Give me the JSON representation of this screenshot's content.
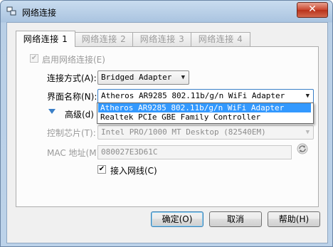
{
  "window": {
    "title": "网络连接",
    "close_label": "✕"
  },
  "tabs": [
    {
      "label": "网络连接 1",
      "active": true
    },
    {
      "label": "网络连接 2",
      "active": false
    },
    {
      "label": "网络连接 3",
      "active": false
    },
    {
      "label": "网络连接 4",
      "active": false
    }
  ],
  "enable_adapter": {
    "label": "启用网络连接(E)",
    "checked": true,
    "disabled": true
  },
  "attached_to": {
    "label": "连接方式(A):",
    "value": "Bridged Adapter"
  },
  "name": {
    "label": "界面名称(N):",
    "value": "Atheros AR9285 802.11b/g/n WiFi Adapter",
    "options": [
      "Atheros AR9285 802.11b/g/n WiFi Adapter",
      "Realtek PCIe GBE Family Controller"
    ],
    "selected_index": 0
  },
  "advanced": {
    "label": "高级(d)"
  },
  "adapter_type": {
    "label": "控制芯片(T):",
    "value": "Intel PRO/1000 MT Desktop (82540EM)"
  },
  "mac": {
    "label": "MAC 地址(M):",
    "value": "080027E3D61C"
  },
  "cable_connected": {
    "label": "接入网线(C)",
    "checked": true
  },
  "buttons": {
    "ok": "确定(O)",
    "cancel": "取消",
    "help": "帮助(H)"
  },
  "colors": {
    "selection": "#3399ff",
    "title_bar": "#bcd2e9",
    "close": "#c9452d"
  }
}
